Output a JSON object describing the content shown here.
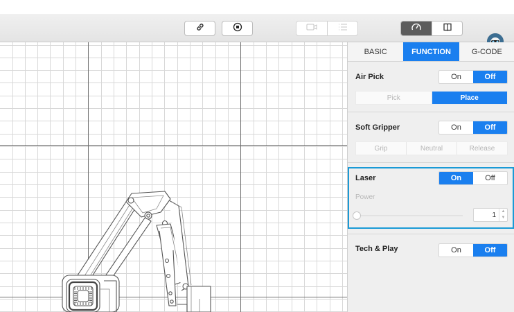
{
  "toolbar": {
    "link_icon": "link-icon",
    "stop_icon": "stop-record-icon",
    "camera_icon": "camera-icon",
    "list_icon": "list-icon",
    "speedometer_icon": "speedometer-icon",
    "book_icon": "book-icon",
    "avatar_icon": "user-avatar"
  },
  "tabs": [
    {
      "label": "BASIC",
      "active": false
    },
    {
      "label": "FUNCTION",
      "active": true
    },
    {
      "label": "G-CODE",
      "active": false
    }
  ],
  "air_pick": {
    "title": "Air Pick",
    "on_label": "On",
    "off_label": "Off",
    "state": "Off",
    "pick_label": "Pick",
    "place_label": "Place",
    "mode": "Place"
  },
  "soft_gripper": {
    "title": "Soft Gripper",
    "on_label": "On",
    "off_label": "Off",
    "state": "Off",
    "grip_label": "Grip",
    "neutral_label": "Neutral",
    "release_label": "Release"
  },
  "laser": {
    "title": "Laser",
    "on_label": "On",
    "off_label": "Off",
    "state": "On",
    "power_label": "Power",
    "power_value": "1",
    "power_slider_fraction": 0
  },
  "tech_play": {
    "title": "Tech & Play",
    "on_label": "On",
    "off_label": "Off",
    "state": "Off"
  },
  "colors": {
    "accent": "#1a7fef",
    "laser_highlight": "#1a9ad6",
    "grid_minor": "#d6d6d6",
    "grid_major": "#6a6a6a"
  }
}
